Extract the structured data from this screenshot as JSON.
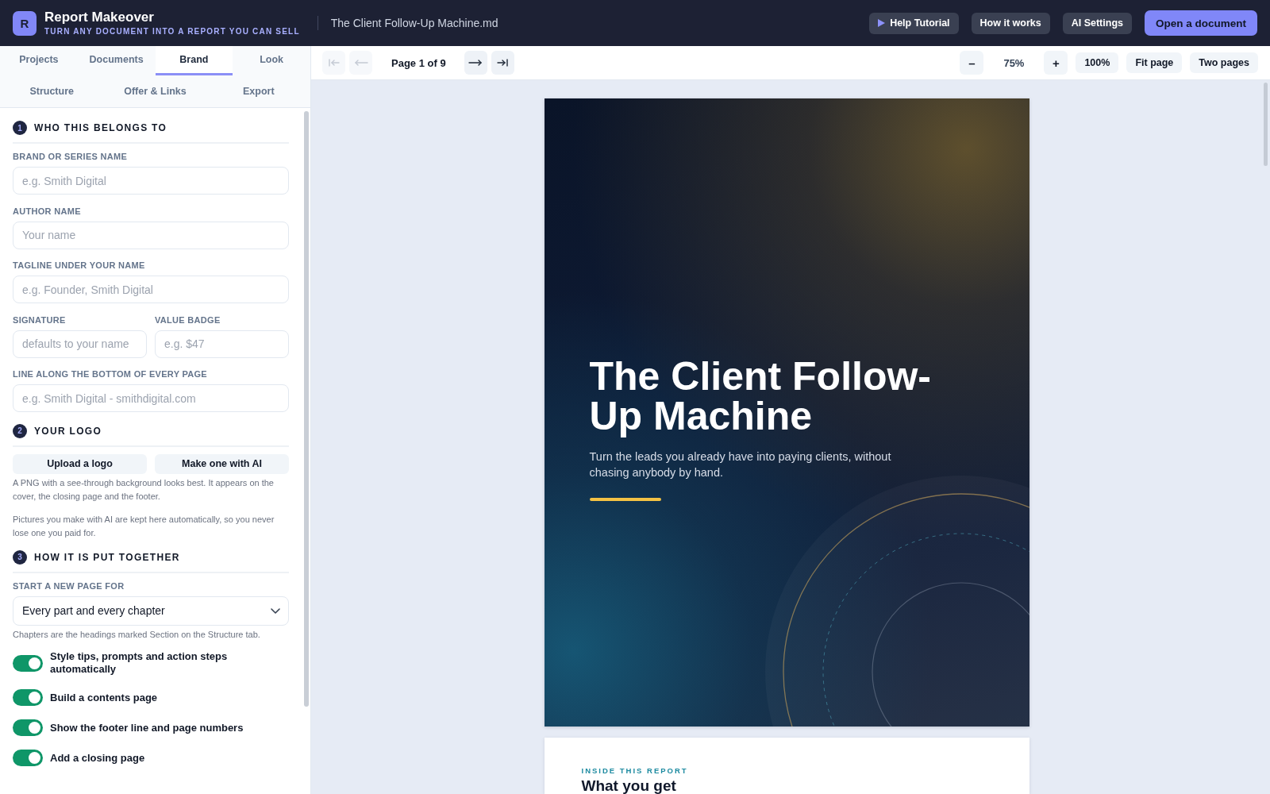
{
  "app": {
    "logo_letter": "R",
    "name": "Report Makeover",
    "tagline": "TURN ANY DOCUMENT INTO A REPORT YOU CAN SELL",
    "document_name": "The Client Follow-Up Machine.md"
  },
  "header_buttons": [
    {
      "label": "Help Tutorial",
      "kind": "tutorial"
    },
    {
      "label": "How it works",
      "kind": "plain"
    },
    {
      "label": "AI Settings",
      "kind": "plain"
    },
    {
      "label": "Open a document",
      "kind": "primary"
    }
  ],
  "sidebar": {
    "tab_rows": [
      [
        {
          "label": "Projects",
          "selected": false
        },
        {
          "label": "Documents",
          "selected": false
        },
        {
          "label": "Brand",
          "selected": true
        },
        {
          "label": "Look",
          "selected": false
        }
      ],
      [
        {
          "label": "Structure",
          "selected": false
        },
        {
          "label": "Offer & Links",
          "selected": false
        },
        {
          "label": "Export",
          "selected": false
        }
      ]
    ],
    "sections": [
      {
        "number": "1",
        "title": "WHO THIS BELONGS TO",
        "items": [
          {
            "kind": "field",
            "label": "BRAND OR SERIES NAME",
            "placeholder": "e.g. Smith Digital"
          },
          {
            "kind": "field",
            "label": "AUTHOR NAME",
            "placeholder": "Your name"
          },
          {
            "kind": "field",
            "label": "TAGLINE UNDER YOUR NAME",
            "placeholder": "e.g. Founder, Smith Digital"
          },
          {
            "kind": "field_pair",
            "fields": [
              {
                "label": "SIGNATURE",
                "placeholder": "defaults to your name"
              },
              {
                "label": "VALUE BADGE",
                "placeholder": "e.g. $47"
              }
            ]
          },
          {
            "kind": "field",
            "label": "LINE ALONG THE BOTTOM OF EVERY PAGE",
            "placeholder": "e.g. Smith Digital - smithdigital.com"
          }
        ]
      },
      {
        "number": "2",
        "title": "YOUR LOGO",
        "items": [
          {
            "kind": "buttons",
            "buttons": [
              "Upload a logo",
              "Make one with AI"
            ]
          },
          {
            "kind": "note",
            "text": "A PNG with a see-through background looks best. It appears on the cover, the closing page and the footer."
          },
          {
            "kind": "note",
            "text": "Pictures you make with AI are kept here automatically, so you never lose one you paid for."
          }
        ]
      },
      {
        "number": "3",
        "title": "HOW IT IS PUT TOGETHER",
        "items": [
          {
            "kind": "select",
            "label": "START A NEW PAGE FOR",
            "value": "Every part and every chapter"
          },
          {
            "kind": "note",
            "text": "Chapters are the headings marked Section on the Structure tab."
          },
          {
            "kind": "toggle",
            "label": "Style tips, prompts and action steps automatically",
            "on": true
          },
          {
            "kind": "toggle",
            "label": "Build a contents page",
            "on": true
          },
          {
            "kind": "toggle",
            "label": "Show the footer line and page numbers",
            "on": true
          },
          {
            "kind": "toggle",
            "label": "Add a closing page",
            "on": true
          }
        ]
      }
    ]
  },
  "viewer": {
    "nav": [
      {
        "kind": "first",
        "disabled": true
      },
      {
        "kind": "prev",
        "disabled": true
      },
      {
        "kind": "page",
        "label": "Page 1 of 9"
      },
      {
        "kind": "next",
        "disabled": false
      },
      {
        "kind": "last",
        "disabled": false
      }
    ],
    "zoom": [
      {
        "kind": "zoom_out",
        "label": "–"
      },
      {
        "kind": "reading",
        "label": "75%"
      },
      {
        "kind": "zoom_in",
        "label": "+"
      },
      {
        "kind": "preset",
        "label": "100%"
      },
      {
        "kind": "preset",
        "label": "Fit page"
      },
      {
        "kind": "preset",
        "label": "Two pages"
      }
    ],
    "pages": [
      {
        "kind": "cover",
        "title": "The Client Follow-Up Machine",
        "subtitle": "Turn the leads you already have into paying clients, without chasing anybody by hand."
      },
      {
        "kind": "contents",
        "eyebrow": "INSIDE THIS REPORT",
        "heading": "What you get"
      }
    ]
  }
}
